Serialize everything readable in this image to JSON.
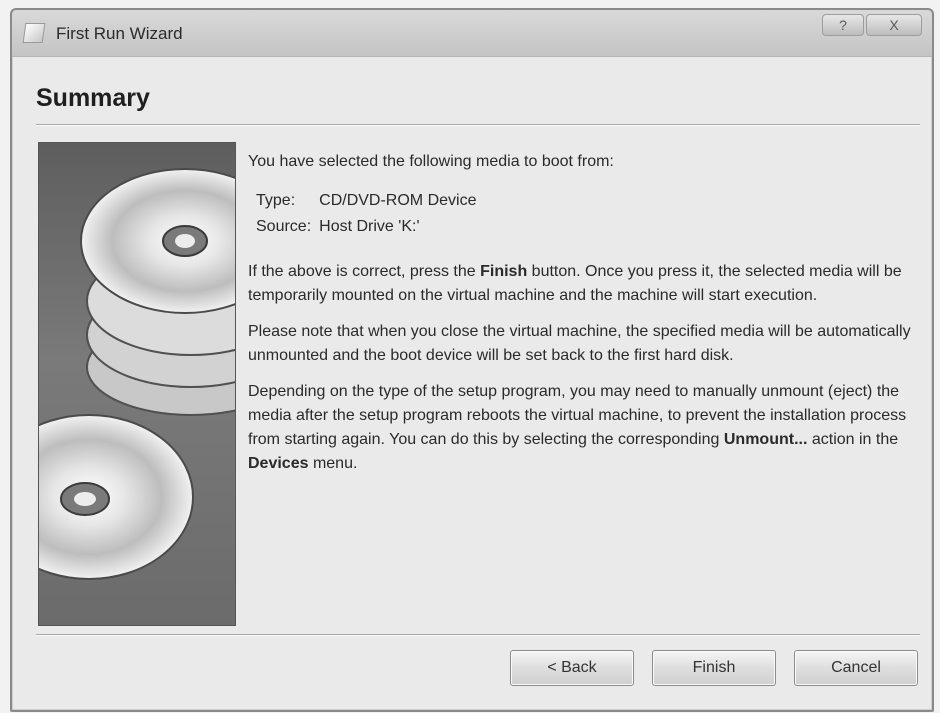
{
  "window": {
    "title": "First Run Wizard",
    "help_glyph": "?",
    "close_glyph": "X"
  },
  "page": {
    "title": "Summary",
    "intro": "You have selected the following media to boot from:",
    "media": [
      {
        "label": "Type:",
        "value": "CD/DVD-ROM Device"
      },
      {
        "label": "Source:",
        "value": "Host Drive 'K:'"
      }
    ],
    "para1_before": "If the above is correct, press the ",
    "para1_bold": "Finish",
    "para1_after": " button. Once you press it, the selected media will be temporarily mounted on the virtual machine and the machine will start execution.",
    "para2": "Please note that when you close the virtual machine, the specified media will be automatically unmounted and the boot device will be set back to the first hard disk.",
    "para3_before": "Depending on the type of the setup program, you may need to manually unmount (eject) the media after the setup program reboots the virtual machine, to prevent the installation process from starting again. You can do this by selecting the corresponding ",
    "para3_bold1": "Unmount...",
    "para3_mid": " action in the ",
    "para3_bold2": "Devices",
    "para3_after": " menu."
  },
  "buttons": {
    "back": "< Back",
    "finish": "Finish",
    "cancel": "Cancel"
  },
  "icons": {
    "app": "wizard-app-icon",
    "sidebar": "cd-stack-icon"
  }
}
